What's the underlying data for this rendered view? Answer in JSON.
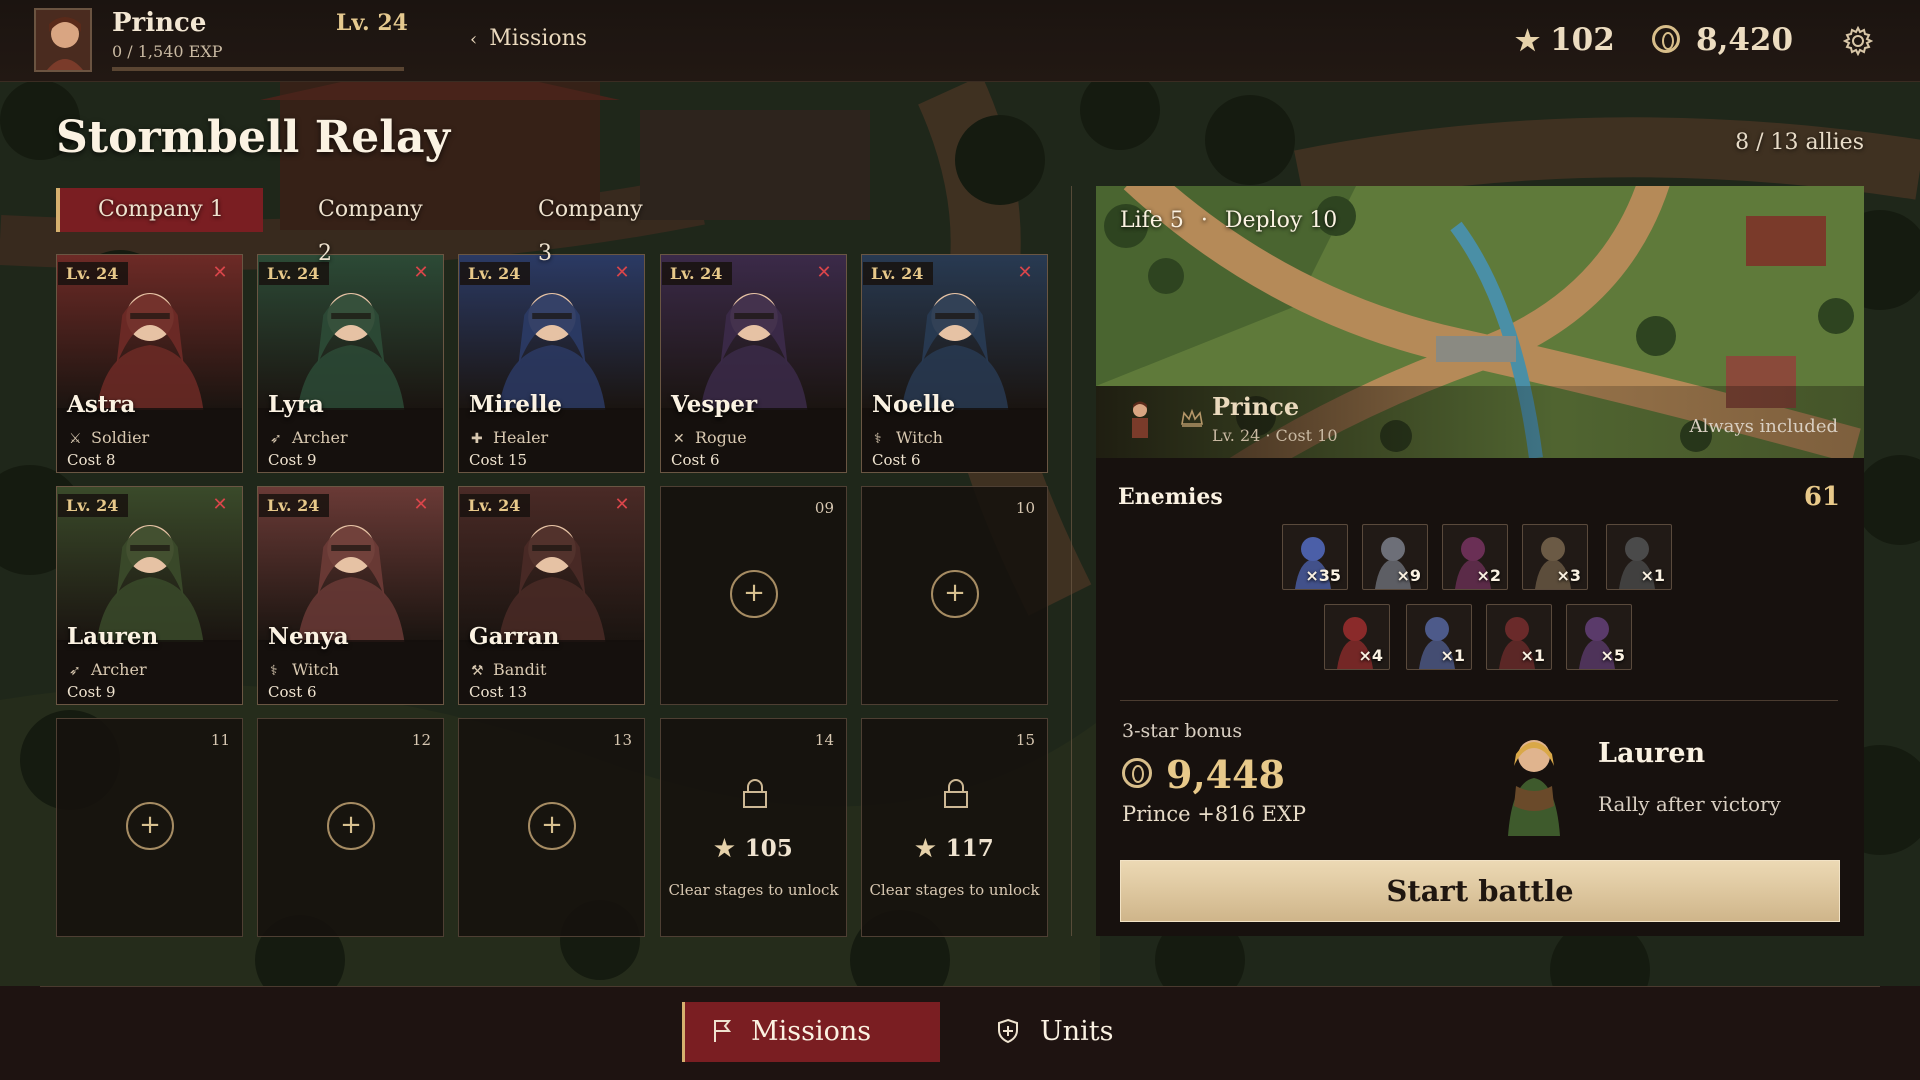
{
  "player": {
    "name": "Prince",
    "exp": "0 / 1,540 EXP",
    "exp_progress": 0,
    "level": "Lv. 24"
  },
  "nav": {
    "back_label": "Missions"
  },
  "currency": {
    "stars": "102",
    "gold": "8,420"
  },
  "mission": {
    "title": "Stormbell Relay",
    "ally_count": "8 / 13 allies",
    "life_label": "Life",
    "life": "5",
    "deploy_label": "Deploy",
    "deploy": "10"
  },
  "companies": [
    "Company 1",
    "Company 2",
    "Company 3"
  ],
  "units": [
    {
      "level": "Lv. 24",
      "name": "Astra",
      "class": "Soldier",
      "cost": "Cost 8",
      "icon": "sword-icon",
      "tint": "#6d2a26"
    },
    {
      "level": "Lv. 24",
      "name": "Lyra",
      "class": "Archer",
      "cost": "Cost 9",
      "icon": "bow-icon",
      "tint": "#2c4a36"
    },
    {
      "level": "Lv. 24",
      "name": "Mirelle",
      "class": "Healer",
      "cost": "Cost 15",
      "icon": "cross-icon",
      "tint": "#2b3a64"
    },
    {
      "level": "Lv. 24",
      "name": "Vesper",
      "class": "Rogue",
      "cost": "Cost 6",
      "icon": "daggers-icon",
      "tint": "#3b2a49"
    },
    {
      "level": "Lv. 24",
      "name": "Noelle",
      "class": "Witch",
      "cost": "Cost 6",
      "icon": "staff-icon",
      "tint": "#283a52"
    },
    {
      "level": "Lv. 24",
      "name": "Lauren",
      "class": "Archer",
      "cost": "Cost 9",
      "icon": "bow-icon",
      "tint": "#3a4a2a"
    },
    {
      "level": "Lv. 24",
      "name": "Nenya",
      "class": "Witch",
      "cost": "Cost 6",
      "icon": "staff-icon",
      "tint": "#6a3a36"
    },
    {
      "level": "Lv. 24",
      "name": "Garran",
      "class": "Bandit",
      "cost": "Cost 13",
      "icon": "axe-icon",
      "tint": "#4a2a26"
    }
  ],
  "empty_slots": [
    "09",
    "10",
    "11",
    "12",
    "13"
  ],
  "locked_slots": [
    {
      "number": "14",
      "stars": "105",
      "hint": "Clear stages to unlock"
    },
    {
      "number": "15",
      "stars": "117",
      "hint": "Clear stages to unlock"
    }
  ],
  "leader": {
    "name": "Prince",
    "meta": "Lv. 24 · Cost 10",
    "note": "Always included"
  },
  "enemies": {
    "title": "Enemies",
    "total": "61",
    "list": [
      {
        "count": "×35",
        "color": "#4b5fa8"
      },
      {
        "count": "×9",
        "color": "#6d6f78"
      },
      {
        "count": "×2",
        "color": "#6a2f55"
      },
      {
        "count": "×3",
        "color": "#6b5a45"
      },
      {
        "count": "×1",
        "color": "#4a4a4a"
      },
      {
        "count": "×4",
        "color": "#8a2a2a"
      },
      {
        "count": "×1",
        "color": "#4d5a8a"
      },
      {
        "count": "×1",
        "color": "#6a2a2a"
      },
      {
        "count": "×5",
        "color": "#5a3a6a"
      }
    ]
  },
  "bonus": {
    "label": "3-star bonus",
    "gold": "9,448",
    "exp": "Prince +816 EXP",
    "ally_name": "Lauren",
    "ally_desc": "Rally after victory"
  },
  "start_label": "Start battle",
  "bottom_nav": {
    "missions": "Missions",
    "units": "Units"
  },
  "colors": {
    "accent_red": "#7a1e22",
    "gold": "#e8c98a",
    "start_button": "#e3cda3"
  }
}
